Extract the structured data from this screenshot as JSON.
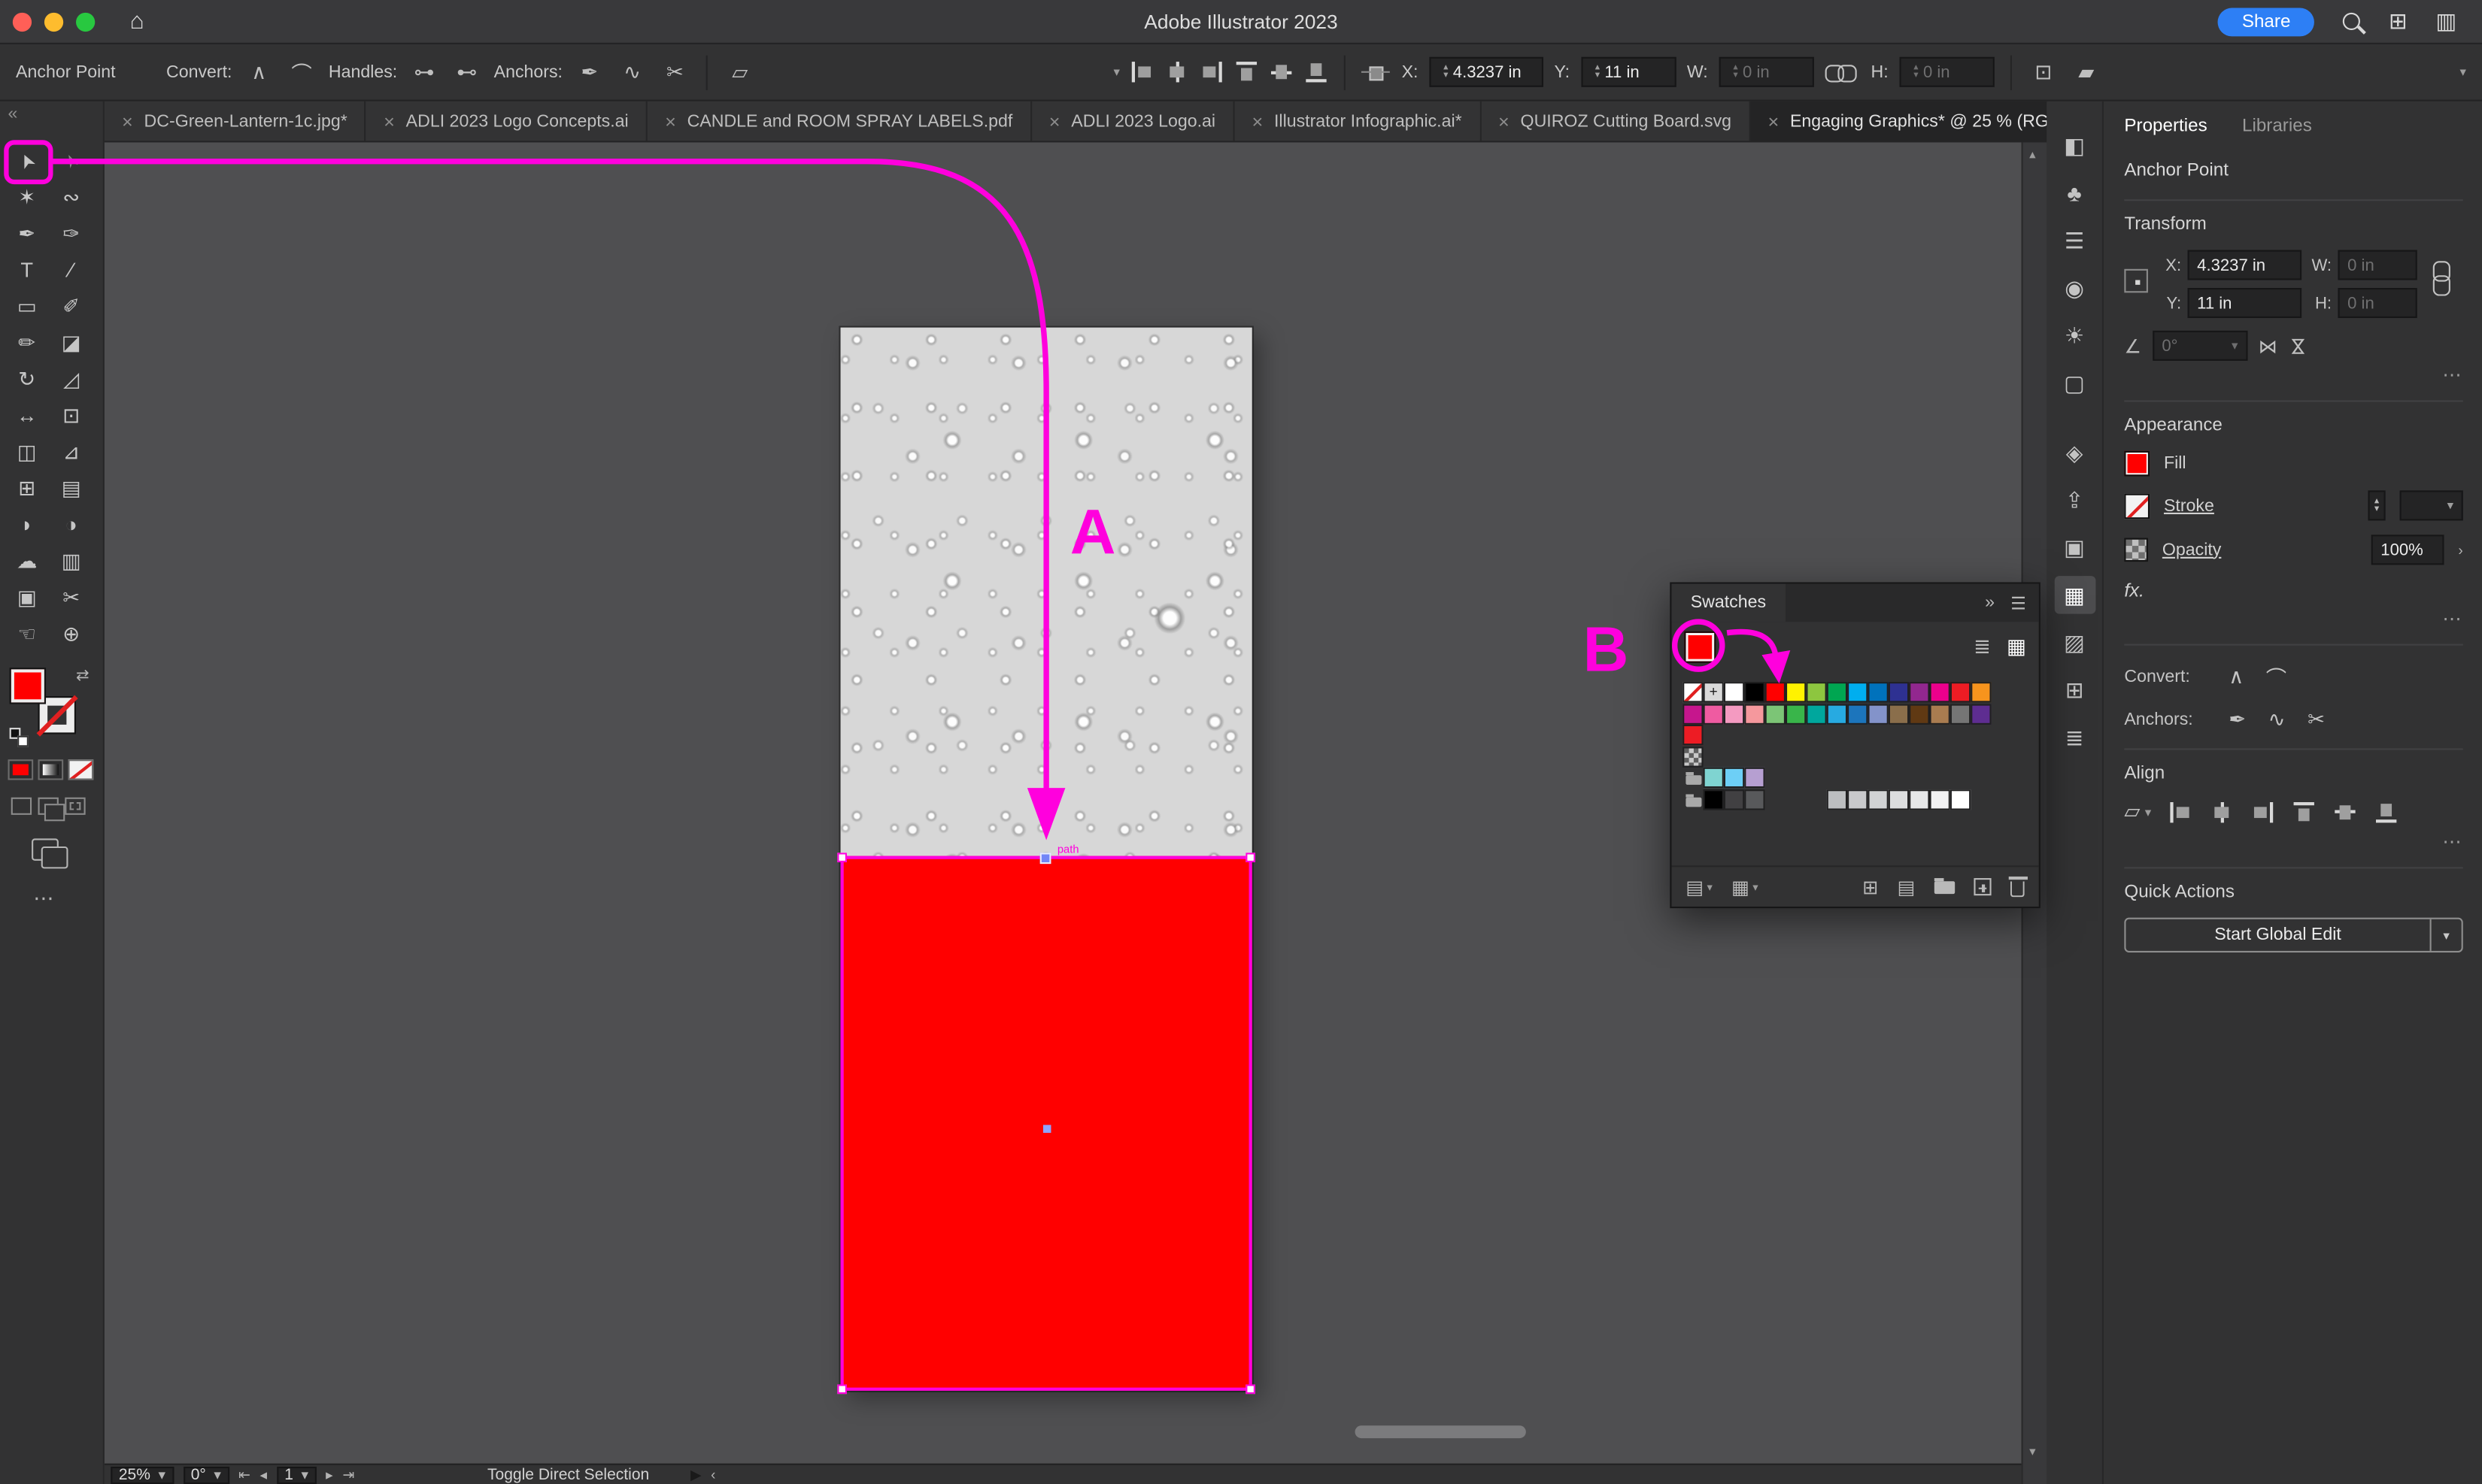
{
  "titlebar": {
    "title": "Adobe Illustrator 2023",
    "share_label": "Share",
    "share_color": "#2d7ff5",
    "traffic": {
      "close": "#ff5f57",
      "minimize": "#febc2e",
      "zoom": "#28c840"
    }
  },
  "icons": {
    "close": "×",
    "home": "⌂",
    "chevrons-left": "«",
    "chevrons-right": "»",
    "chevron-down": "▾",
    "chevron-up": "▴",
    "chevron-right-small": "›",
    "chevron-left-small": "‹",
    "menu": "☰",
    "ellipsis": "⋯",
    "window-grid": "⊞",
    "sidebar": "▥",
    "swap": "⇄",
    "convert-corner": "∧",
    "convert-smooth": "⌒",
    "show-handles": "⊶",
    "hide-handles": "⊷",
    "remove-anchor": "✒",
    "connect-anchors": "∿",
    "cut-anchors": "✂",
    "arrange": "▱",
    "free-transform": "⊡",
    "shear": "▰",
    "angle": "∠",
    "flip": "⋈",
    "first": "⇤",
    "prev": "◂",
    "next": "▸",
    "last": "⇥",
    "play": "▶",
    "list-view": "≣",
    "grid-view": "▦",
    "libraries-sw": "▤",
    "swatch-kinds": "▦",
    "swatch-table": "⊞",
    "swatch-list": "▤",
    "up": "▴",
    "down": "▾"
  },
  "control_bar": {
    "context_label": "Anchor Point",
    "convert_label": "Convert:",
    "handles_label": "Handles:",
    "anchors_label": "Anchors:",
    "x_label": "X:",
    "x_value": "4.3237 in",
    "y_label": "Y:",
    "y_value": "11 in",
    "w_label": "W:",
    "w_value": "0 in",
    "h_label": "H:",
    "h_value": "0 in"
  },
  "tabs": [
    {
      "label": "DC-Green-Lantern-1c.jpg*",
      "active": false
    },
    {
      "label": "ADLI 2023 Logo Concepts.ai",
      "active": false
    },
    {
      "label": "CANDLE and ROOM SPRAY LABELS.pdf",
      "active": false
    },
    {
      "label": "ADLI 2023 Logo.ai",
      "active": false
    },
    {
      "label": "Illustrator Infographic.ai*",
      "active": false
    },
    {
      "label": "QUIROZ Cutting Board.svg",
      "active": false
    },
    {
      "label": "Engaging Graphics* @ 25 % (RG",
      "active": true
    }
  ],
  "toolbar": {
    "tools": [
      {
        "name": "selection-tool",
        "glyph": "➤",
        "active": true
      },
      {
        "name": "direct-selection-tool",
        "glyph": "➢"
      },
      {
        "name": "magic-wand-tool",
        "glyph": "✶"
      },
      {
        "name": "lasso-tool",
        "glyph": "∾"
      },
      {
        "name": "pen-tool",
        "glyph": "✒"
      },
      {
        "name": "curvature-tool",
        "glyph": "✑"
      },
      {
        "name": "type-tool",
        "glyph": "T"
      },
      {
        "name": "line-segment-tool",
        "glyph": "∕"
      },
      {
        "name": "rectangle-tool",
        "glyph": "▭"
      },
      {
        "name": "paintbrush-tool",
        "glyph": "✐"
      },
      {
        "name": "shaper-tool",
        "glyph": "✏"
      },
      {
        "name": "eraser-tool",
        "glyph": "◪"
      },
      {
        "name": "rotate-tool",
        "glyph": "↻"
      },
      {
        "name": "scale-tool",
        "glyph": "◿"
      },
      {
        "name": "width-tool",
        "glyph": "↔"
      },
      {
        "name": "free-transform-tool",
        "glyph": "⊡"
      },
      {
        "name": "shape-builder-tool",
        "glyph": "◫"
      },
      {
        "name": "perspective-grid-tool",
        "glyph": "⊿"
      },
      {
        "name": "mesh-tool",
        "glyph": "⊞"
      },
      {
        "name": "gradient-tool",
        "glyph": "▤"
      },
      {
        "name": "eyedropper-tool",
        "glyph": "◗"
      },
      {
        "name": "blend-tool",
        "glyph": "◑"
      },
      {
        "name": "symbol-sprayer-tool",
        "glyph": "☁"
      },
      {
        "name": "column-graph-tool",
        "glyph": "▥"
      },
      {
        "name": "artboard-tool",
        "glyph": "▣"
      },
      {
        "name": "slice-tool",
        "glyph": "✂"
      },
      {
        "name": "hand-tool",
        "glyph": "☜"
      },
      {
        "name": "zoom-tool",
        "glyph": "⊕"
      }
    ],
    "fill_color": "#ff0000"
  },
  "panel_strip": [
    {
      "name": "pathfinder-icon",
      "glyph": "◧"
    },
    {
      "name": "symbols-icon",
      "glyph": "♣"
    },
    {
      "name": "stroke-icon",
      "glyph": "☰"
    },
    {
      "name": "gradient-icon",
      "glyph": "◉"
    },
    {
      "name": "appearance-icon",
      "glyph": "☀"
    },
    {
      "name": "artboards-icon",
      "glyph": "▢"
    },
    {
      "name": "layers-icon",
      "glyph": "◈"
    },
    {
      "name": "export-icon",
      "glyph": "⇪"
    },
    {
      "name": "asset-export-icon",
      "glyph": "▣"
    },
    {
      "name": "swatches-icon",
      "glyph": "▦",
      "active": true
    },
    {
      "name": "color-guide-icon",
      "glyph": "▨"
    },
    {
      "name": "transform-icon",
      "glyph": "⊞"
    },
    {
      "name": "align-icon",
      "glyph": "≣"
    }
  ],
  "swatches_panel": {
    "title": "Swatches",
    "selected_color": "#ff0000",
    "rows": {
      "row1": [
        "none",
        "reg",
        "#ffffff",
        "#000000",
        "#ff0000",
        "#fff200",
        "#8dc63f",
        "#00a651",
        "#00aeef",
        "#0072bc",
        "#2e3192",
        "#92278f",
        "#ec008c",
        "#ed1c24",
        "#f7941d"
      ],
      "row2": [
        "#c6168d",
        "#ef5ba1",
        "#f49ac1",
        "#f5989d",
        "#7cc576",
        "#39b54a",
        "#00a79d",
        "#27aae1",
        "#1c75bc",
        "#8393ca",
        "#8a6e4b",
        "#603913",
        "#a97c50",
        "#757575",
        "#5e2d91"
      ],
      "row3": [
        "#ed1c24"
      ],
      "row4": [
        "pattern"
      ],
      "row5": [
        "folder",
        "#7fd4d1",
        "#6dcff6",
        "#b69fd1"
      ],
      "row6": [
        "folder",
        "#000000",
        "#414042",
        "#58595b",
        "gap",
        "gap",
        "gap",
        "#bcbec0",
        "#c8c9cb",
        "#d1d3d4",
        "#dcddde",
        "#e6e7e8",
        "#f1f1f2",
        "#ffffff"
      ]
    }
  },
  "properties_panel": {
    "tabs": {
      "properties": "Properties",
      "libraries": "Libraries"
    },
    "selection_label": "Anchor Point",
    "transform": {
      "title": "Transform",
      "x_label": "X:",
      "x_value": "4.3237 in",
      "y_label": "Y:",
      "y_value": "11 in",
      "w_label": "W:",
      "w_value": "0 in",
      "h_label": "H:",
      "h_value": "0 in",
      "angle_value": "0°"
    },
    "appearance": {
      "title": "Appearance",
      "fill_label": "Fill",
      "fill_color": "#ff0000",
      "stroke_label": "Stroke",
      "opacity_label": "Opacity",
      "opacity_value": "100%",
      "fx_label": "fx."
    },
    "convert_label": "Convert:",
    "anchors_label": "Anchors:",
    "align_title": "Align",
    "quick_actions": {
      "title": "Quick Actions",
      "button_label": "Start Global Edit"
    }
  },
  "status_bar": {
    "zoom_value": "25%",
    "rotation_value": "0°",
    "page_value": "1",
    "tool_hint": "Toggle Direct Selection"
  },
  "artboard": {
    "bottom_fill": "#ff0000"
  },
  "annotations": {
    "color": "#ff00dd",
    "label_a": "A",
    "label_b": "B",
    "path_label": "path"
  }
}
